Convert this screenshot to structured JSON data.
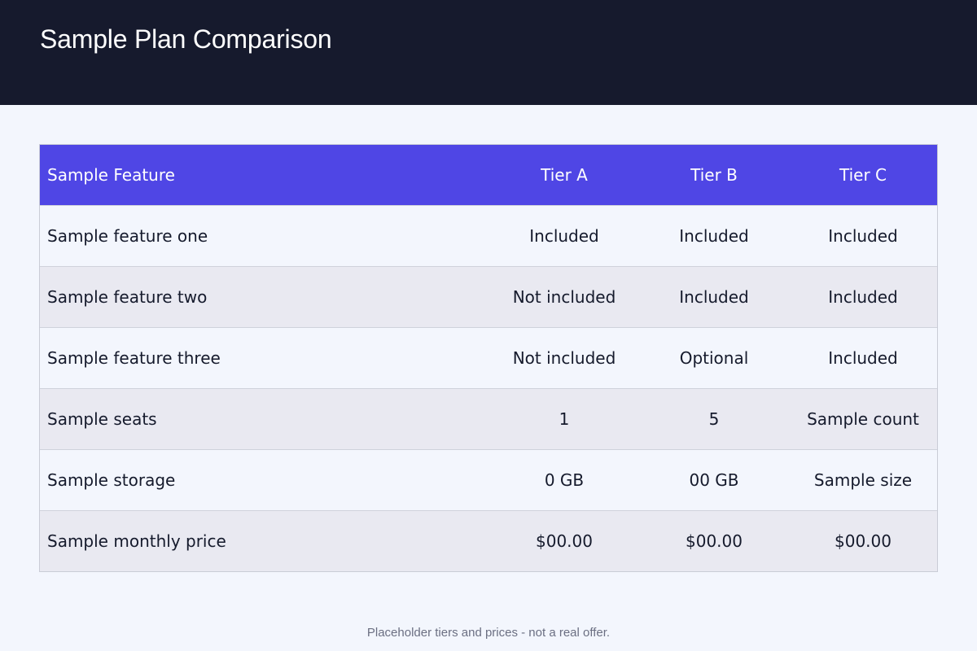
{
  "page": {
    "title": "Sample Plan Comparison",
    "footer_note": "Placeholder tiers and prices - not a real offer."
  },
  "colors": {
    "header_bg": "#161a2d",
    "table_header_bg": "#4f46e5",
    "row_light": "#f3f6fd",
    "row_dark": "#e9e9f1"
  },
  "table": {
    "headers": [
      "Sample Feature",
      "Tier A",
      "Tier B",
      "Tier C"
    ],
    "rows": [
      [
        "Sample feature one",
        "Included",
        "Included",
        "Included"
      ],
      [
        "Sample feature two",
        "Not included",
        "Included",
        "Included"
      ],
      [
        "Sample feature three",
        "Not included",
        "Optional",
        "Included"
      ],
      [
        "Sample seats",
        "1",
        "5",
        "Sample count"
      ],
      [
        "Sample storage",
        "0 GB",
        "00 GB",
        "Sample size"
      ],
      [
        "Sample monthly price",
        "$00.00",
        "$00.00",
        "$00.00"
      ]
    ]
  }
}
